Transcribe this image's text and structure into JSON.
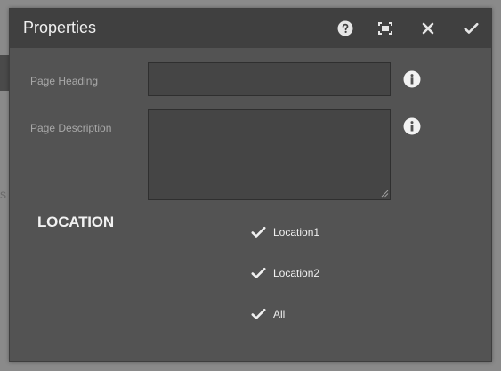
{
  "dialog": {
    "title": "Properties",
    "header_icons": [
      "help-icon",
      "fullscreen-icon",
      "close-icon",
      "checkmark-icon"
    ]
  },
  "form": {
    "page_heading": {
      "label": "Page Heading",
      "value": ""
    },
    "page_description": {
      "label": "Page Description",
      "value": ""
    }
  },
  "location": {
    "title": "LOCATION",
    "options": [
      {
        "label": "Location1",
        "checked": true
      },
      {
        "label": "Location2",
        "checked": true
      },
      {
        "label": "All",
        "checked": true
      }
    ]
  },
  "colors": {
    "dialog_bg": "#535353",
    "header_bg": "#404040",
    "input_bg": "#454545",
    "text": "#f0f0f0",
    "label_text": "#a8a8a8"
  }
}
